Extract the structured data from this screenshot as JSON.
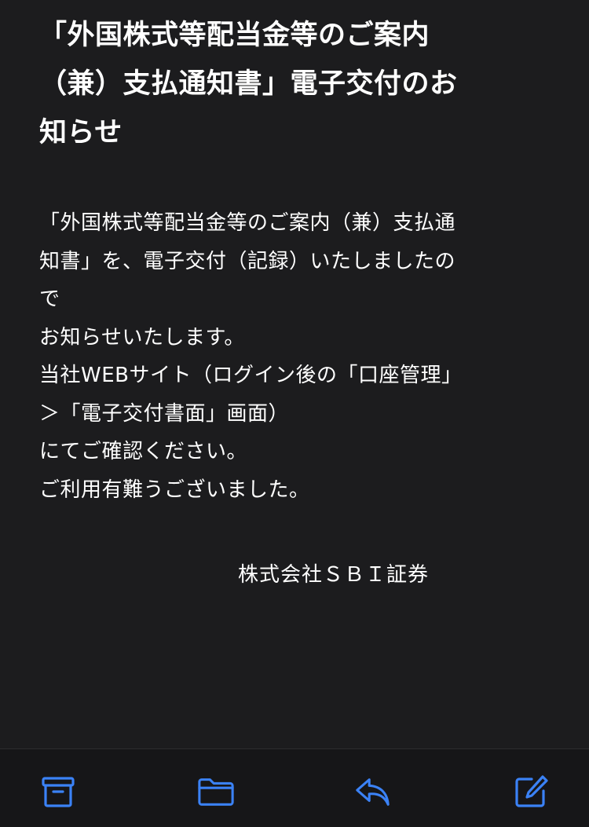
{
  "email": {
    "subject_lines": [
      "「外国株式等配当金等のご案内",
      "（兼）支払通知書」電子交付のお",
      "知らせ"
    ],
    "body_lines": [
      "「外国株式等配当金等のご案内（兼）支払通",
      "知書」を、電子交付（記録）いたしましたの",
      "で",
      "お知らせいたします。",
      "当社WEBサイト（ログイン後の「口座管理」",
      "＞「電子交付書面」画面）",
      "にてご確認ください。",
      "ご利用有難うございました。"
    ],
    "signature": "株式会社ＳＢＩ証券"
  },
  "toolbar": {
    "icons": [
      "archive-icon",
      "folder-icon",
      "reply-icon",
      "compose-icon"
    ],
    "accent_color": "#3b82f6"
  }
}
